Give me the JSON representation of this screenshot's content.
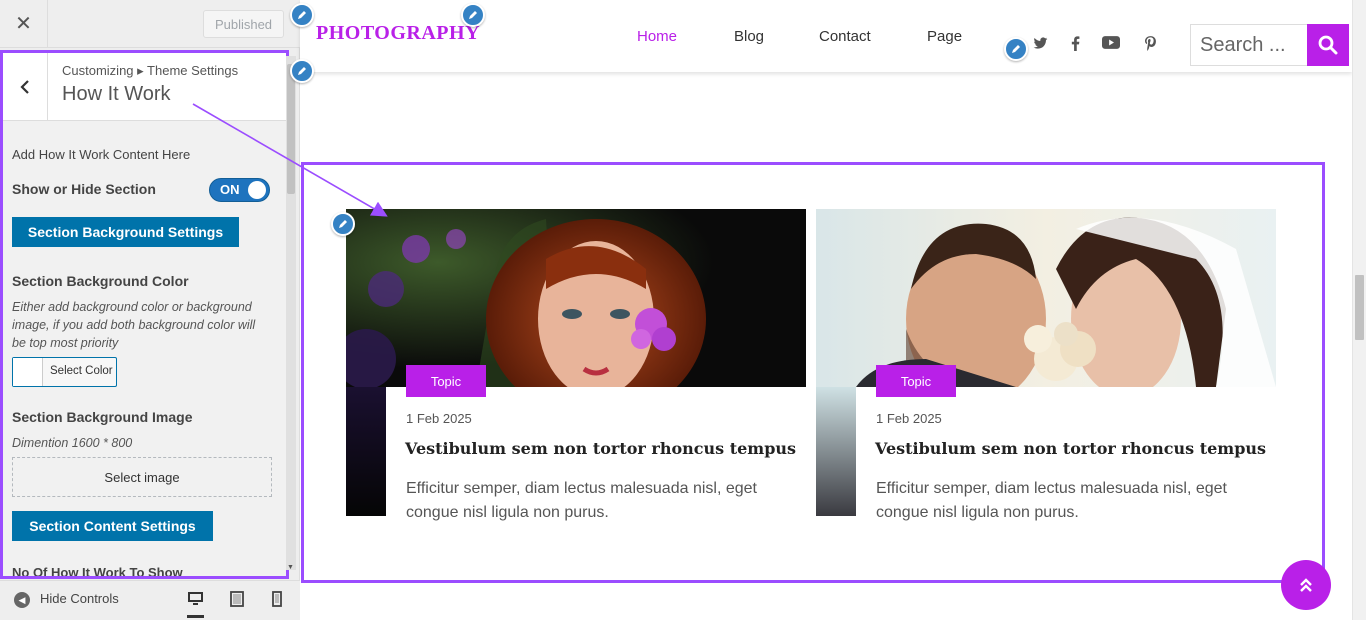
{
  "sidebar": {
    "close_icon": "close-icon",
    "published_label": "Published",
    "breadcrumb": "Customizing ▸ Theme Settings",
    "panel_title": "How It Work",
    "intro": "Add How It Work Content Here",
    "show_hide_label": "Show or Hide Section",
    "toggle_state": "ON",
    "bg_settings_button": "Section Background Settings",
    "bg_color_label": "Section Background Color",
    "bg_color_desc": "Either add background color or background image, if you add both background color will be top most priority",
    "select_color_label": "Select Color",
    "bg_image_label": "Section Background Image",
    "bg_image_desc": "Dimention 1600 * 800",
    "select_image_label": "Select image",
    "content_settings_button": "Section Content Settings",
    "count_label": "No Of How It Work To Show",
    "hide_controls_label": "Hide Controls"
  },
  "site": {
    "logo": "PHOTOGRAPHY",
    "nav": [
      {
        "label": "Home",
        "active": true
      },
      {
        "label": "Blog"
      },
      {
        "label": "Contact"
      },
      {
        "label": "Page"
      }
    ],
    "social_icons": [
      "twitter-icon",
      "facebook-icon",
      "youtube-icon",
      "pinterest-icon"
    ],
    "search_placeholder": "Search ...",
    "accent_color": "#b920e8",
    "cards": [
      {
        "image": "woman-with-purple-flower-photo",
        "tag": "Topic",
        "date": "1 Feb 2025",
        "title": "Vestibulum sem non tortor rhoncus tempus",
        "excerpt": "Efficitur semper, diam lectus malesuada nisl, eget congue nisl ligula non purus."
      },
      {
        "image": "wedding-couple-photo",
        "tag": "Topic",
        "date": "1 Feb 2025",
        "title": "Vestibulum sem non tortor rhoncus tempus",
        "excerpt": "Efficitur semper, diam lectus malesuada nisl, eget congue nisl ligula non purus."
      }
    ]
  },
  "colors": {
    "highlight": "#9b4dff",
    "wp_blue": "#0073aa",
    "edit_pencil": "#3582c4"
  }
}
